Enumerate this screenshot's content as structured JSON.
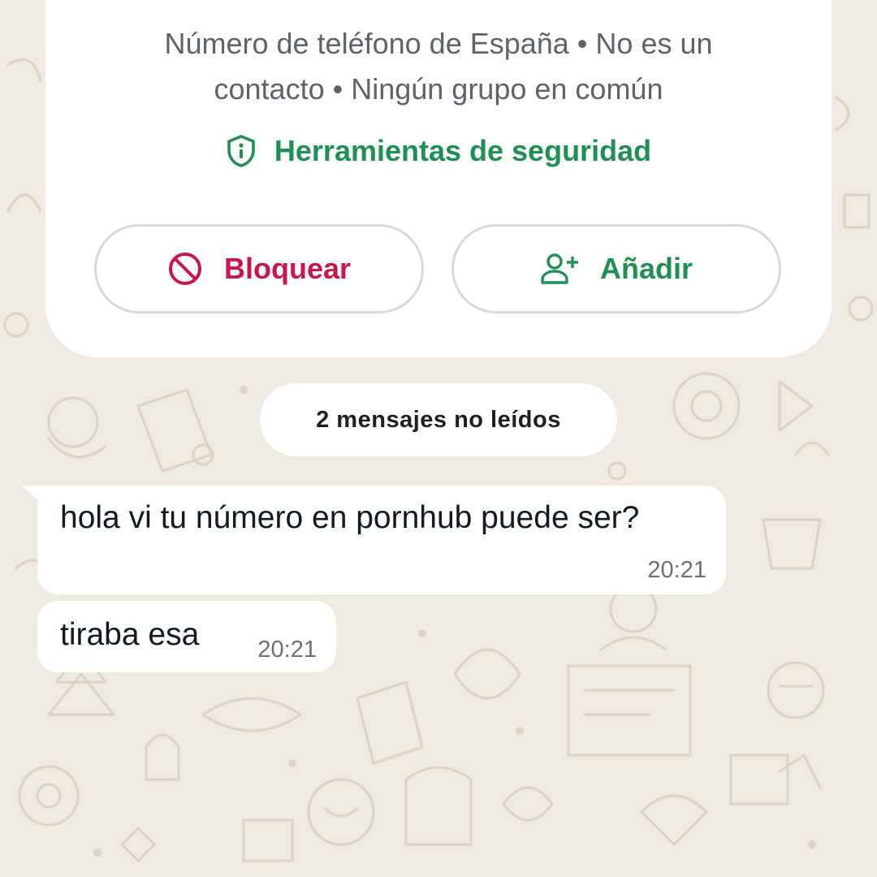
{
  "contact": {
    "info_line_1": "Número de teléfono de España • No es un",
    "info_line_2": "contacto • Ningún grupo en común",
    "security_tools": "Herramientas de seguridad",
    "security_icon": "shield-info-icon",
    "block_label": "Bloquear",
    "block_icon": "block-circle-icon",
    "add_label": "Añadir",
    "add_icon": "add-person-icon"
  },
  "unread_banner": "2 mensajes no leídos",
  "messages": [
    {
      "text": "hola vi tu número en pornhub puede ser?",
      "time": "20:21"
    },
    {
      "text": "tiraba esa",
      "time": "20:21"
    }
  ],
  "colors": {
    "background": "#efeae2",
    "accent_green": "#1f8f56",
    "block_red": "#c8174b",
    "card": "#ffffff"
  }
}
